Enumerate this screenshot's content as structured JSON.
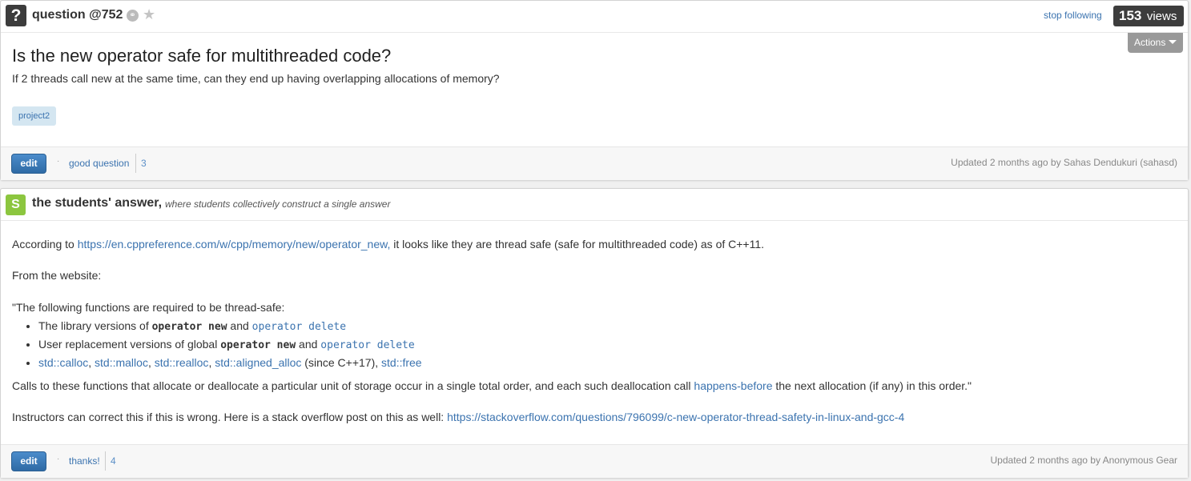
{
  "question": {
    "label": "question @752",
    "stop_following": "stop following",
    "views_count": "153",
    "views_label": "views",
    "actions_label": "Actions",
    "title": "Is the new operator safe for multithreaded code?",
    "body": "If 2 threads call new at the same time, can they end up having overlapping allocations of memory?",
    "tag": "project2",
    "edit_label": "edit",
    "good_question_label": "good question",
    "good_question_count": "3",
    "updated": "Updated 2 months ago by Sahas Dendukuri (sahasd)"
  },
  "answer": {
    "title": "the students' answer,",
    "subtitle": "where students collectively construct a single answer",
    "p1_prefix": "According to",
    "p1_link": "https://en.cppreference.com/w/cpp/memory/new/operator_new,",
    "p1_suffix": "it looks like they are thread safe (safe for multithreaded code) as of C++11.",
    "p2": "From the website:",
    "p3": "\"The following functions are required to be thread-safe:",
    "li1_prefix": "The library versions of",
    "li1_code1": "operator new",
    "li1_and": "and",
    "li1_code2": "operator delete",
    "li2_prefix": "User replacement versions of global",
    "li2_code1": "operator new",
    "li2_and": "and",
    "li2_code2": "operator delete",
    "li3_links": [
      "std::calloc",
      "std::malloc",
      "std::realloc",
      "std::aligned_alloc"
    ],
    "li3_since": "(since C++17),",
    "li3_last": "std::free",
    "p4_prefix": "Calls to these functions that allocate or deallocate a particular unit of storage occur in a single total order, and each such deallocation call",
    "p4_link": "happens-before",
    "p4_suffix": "the next allocation (if any) in this order.\"",
    "p5_prefix": "Instructors can correct this if this is wrong. Here is a stack overflow post on this as well:",
    "p5_link": "https://stackoverflow.com/questions/796099/c-new-operator-thread-safety-in-linux-and-gcc-4",
    "edit_label": "edit",
    "thanks_label": "thanks!",
    "thanks_count": "4",
    "updated": "Updated 2 months ago by Anonymous Gear"
  },
  "icons": {
    "question": "question-mark-icon",
    "link": "link-icon",
    "star": "star-icon",
    "students": "students-s-icon",
    "caret": "caret-down-icon"
  },
  "colors": {
    "link": "#3b73af",
    "edit_button": "#2f6ba5",
    "views_badge": "#3d3d3d",
    "actions_button": "#999999",
    "students_icon": "#8cc63f",
    "tag_bg": "#d4e6f1"
  }
}
